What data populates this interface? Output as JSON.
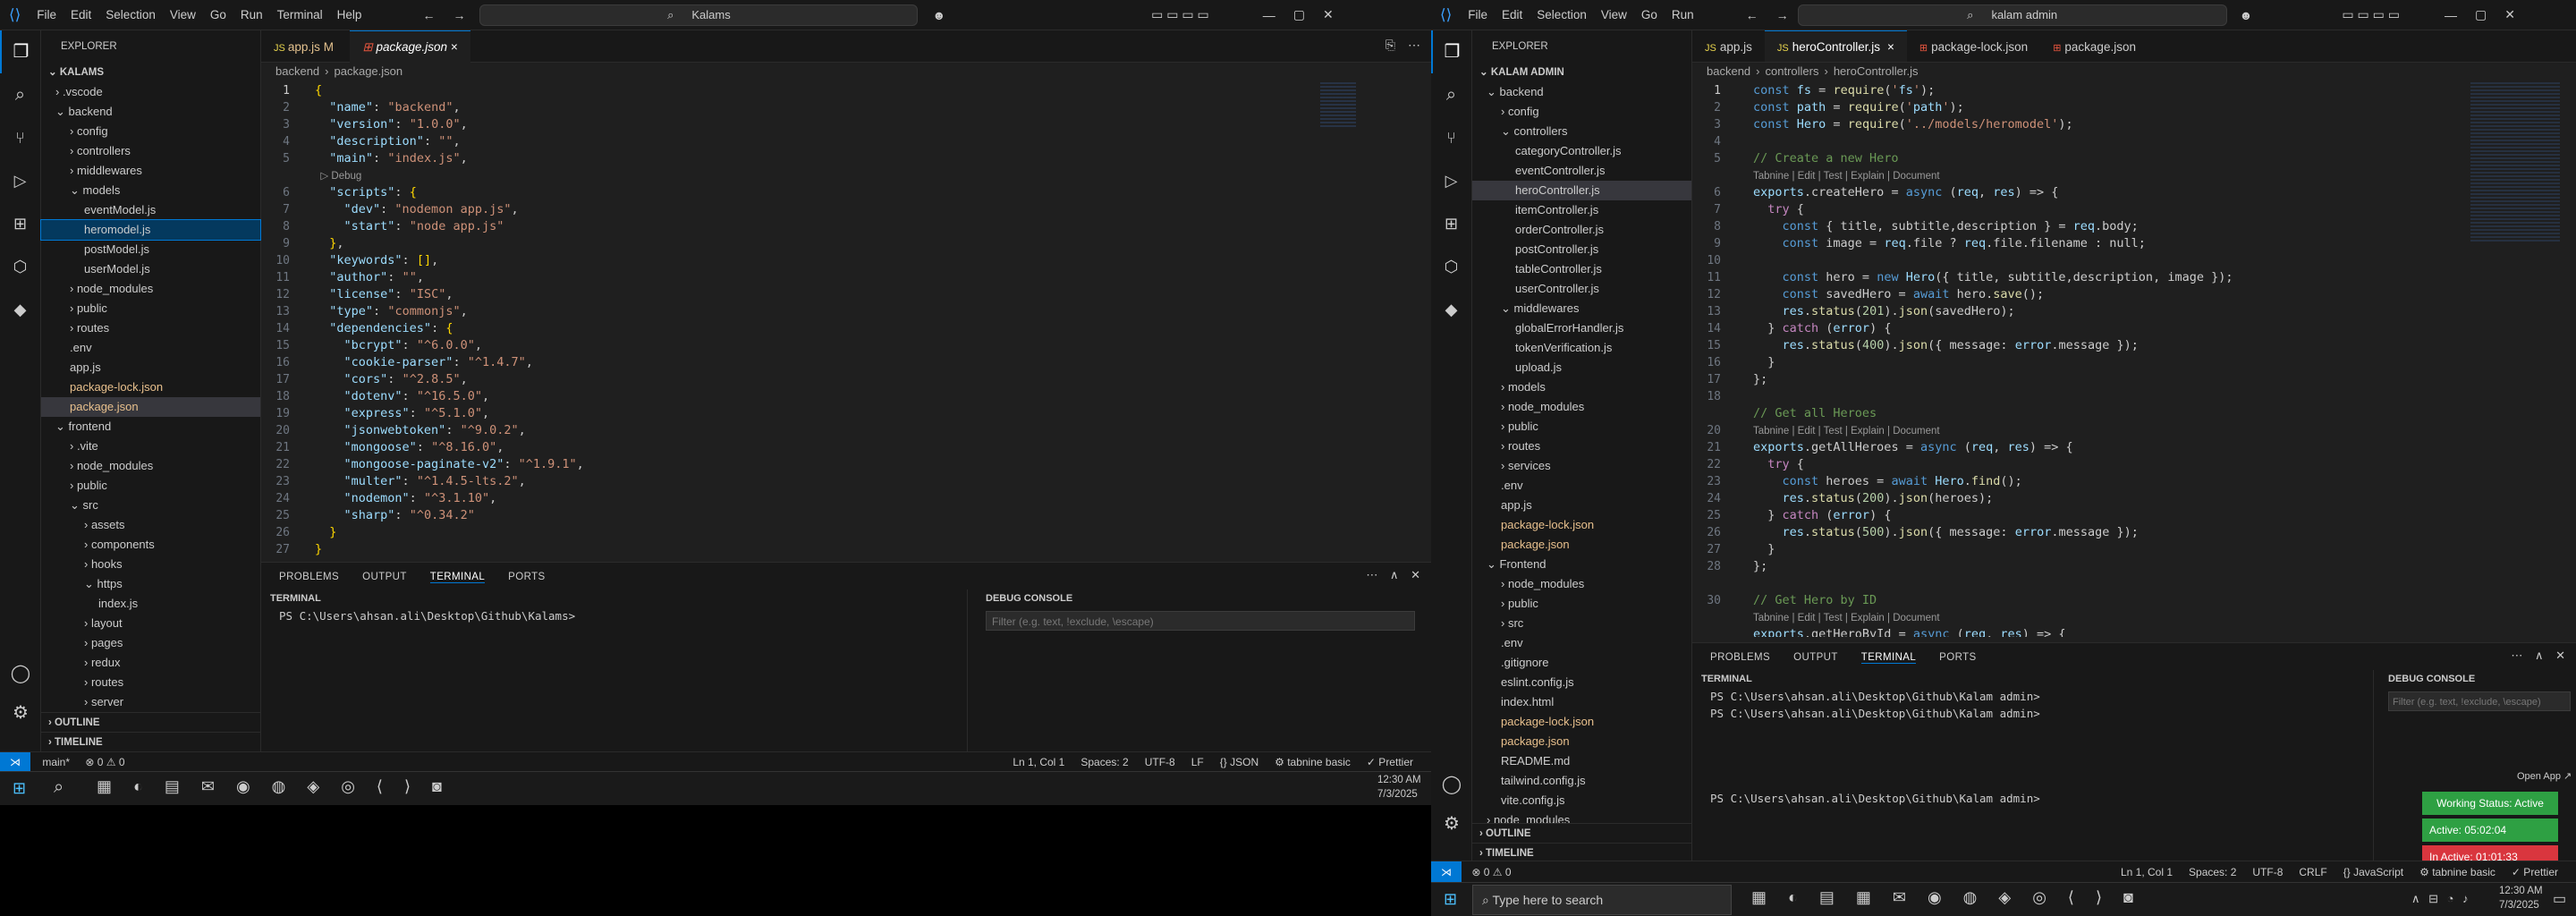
{
  "left": {
    "menu": [
      "File",
      "Edit",
      "Selection",
      "View",
      "Go",
      "Run",
      "Terminal",
      "Help"
    ],
    "search": "Kalams",
    "explorer_title": "EXPLORER",
    "root": "KALAMS",
    "tree": [
      {
        "t": "› .vscode",
        "d": 1
      },
      {
        "t": "⌄ backend",
        "d": 1
      },
      {
        "t": "› config",
        "d": 2
      },
      {
        "t": "› controllers",
        "d": 2
      },
      {
        "t": "› middlewares",
        "d": 2
      },
      {
        "t": "⌄ models",
        "d": 2
      },
      {
        "t": "eventModel.js",
        "d": 3
      },
      {
        "t": "heromodel.js",
        "d": 3
      },
      {
        "t": "postModel.js",
        "d": 3
      },
      {
        "t": "userModel.js",
        "d": 3
      },
      {
        "t": "› node_modules",
        "d": 2
      },
      {
        "t": "› public",
        "d": 2
      },
      {
        "t": "› routes",
        "d": 2
      },
      {
        "t": ".env",
        "d": 2
      },
      {
        "t": "app.js",
        "d": 2
      },
      {
        "t": "package-lock.json",
        "d": 2
      },
      {
        "t": "package.json",
        "d": 2
      },
      {
        "t": "⌄ frontend",
        "d": 1
      },
      {
        "t": "› .vite",
        "d": 2
      },
      {
        "t": "› node_modules",
        "d": 2
      },
      {
        "t": "› public",
        "d": 2
      },
      {
        "t": "⌄ src",
        "d": 2
      },
      {
        "t": "› assets",
        "d": 3
      },
      {
        "t": "› components",
        "d": 3
      },
      {
        "t": "› hooks",
        "d": 3
      },
      {
        "t": "⌄ https",
        "d": 3
      },
      {
        "t": "index.js",
        "d": 4
      },
      {
        "t": "› layout",
        "d": 3
      },
      {
        "t": "› pages",
        "d": 3
      },
      {
        "t": "› redux",
        "d": 3
      },
      {
        "t": "› routes",
        "d": 3
      },
      {
        "t": "› server",
        "d": 3
      }
    ],
    "outline": "OUTLINE",
    "timeline": "TIMELINE",
    "tabs": [
      {
        "label": "app.js",
        "flag": "M"
      },
      {
        "label": "package.json",
        "flag": "×"
      }
    ],
    "breadcrumb": [
      "backend",
      "›",
      "package.json"
    ],
    "code": [
      "{",
      "  \"name\": \"backend\",",
      "  \"version\": \"1.0.0\",",
      "  \"description\": \"\",",
      "  \"main\": \"index.js\",",
      "  ▷ Debug",
      "  \"scripts\": {",
      "    \"dev\": \"nodemon app.js\",",
      "    \"start\": \"node app.js\"",
      "  },",
      "  \"keywords\": [],",
      "  \"author\": \"\",",
      "  \"license\": \"ISC\",",
      "  \"type\": \"commonjs\",",
      "  \"dependencies\": {",
      "    \"bcrypt\": \"^6.0.0\",",
      "    \"cookie-parser\": \"^1.4.7\",",
      "    \"cors\": \"^2.8.5\",",
      "    \"dotenv\": \"^16.5.0\",",
      "    \"express\": \"^5.1.0\",",
      "    \"jsonwebtoken\": \"^9.0.2\",",
      "    \"mongoose\": \"^8.16.0\",",
      "    \"mongoose-paginate-v2\": \"^1.9.1\",",
      "    \"multer\": \"^1.4.5-lts.2\",",
      "    \"nodemon\": \"^3.1.10\",",
      "    \"sharp\": \"^0.34.2\"",
      "  }",
      "}"
    ],
    "linenums": [
      "1",
      "2",
      "3",
      "4",
      "5",
      "",
      "6",
      "7",
      "8",
      "9",
      "10",
      "11",
      "12",
      "13",
      "14",
      "15",
      "16",
      "17",
      "18",
      "19",
      "20",
      "21",
      "22",
      "23",
      "24",
      "25",
      "26",
      "27"
    ],
    "panel_tabs": [
      "PROBLEMS",
      "OUTPUT",
      "TERMINAL",
      "PORTS"
    ],
    "terminal_label": "TERMINAL",
    "terminal_line": "PS C:\\Users\\ahsan.ali\\Desktop\\Github\\Kalams>",
    "debug_label": "DEBUG CONSOLE",
    "debug_filter": "Filter (e.g. text, !exclude, \\escape)",
    "status_left": [
      "main*",
      "⊗ 0 ⚠ 0"
    ],
    "status_right": [
      "Ln 1, Col 1",
      "Spaces: 2",
      "UTF-8",
      "LF",
      "{} JSON",
      "⚙ tabnine basic",
      "✓ Prettier"
    ],
    "time": "12:30 AM",
    "date": "7/3/2025"
  },
  "right": {
    "menu": [
      "File",
      "Edit",
      "Selection",
      "View",
      "Go",
      "Run"
    ],
    "search": "kalam admin",
    "explorer_title": "EXPLORER",
    "root": "KALAM ADMIN",
    "tree": [
      {
        "t": "⌄ backend",
        "d": 1
      },
      {
        "t": "› config",
        "d": 2
      },
      {
        "t": "⌄ controllers",
        "d": 2
      },
      {
        "t": "categoryController.js",
        "d": 3
      },
      {
        "t": "eventController.js",
        "d": 3
      },
      {
        "t": "heroController.js",
        "d": 3
      },
      {
        "t": "itemController.js",
        "d": 3
      },
      {
        "t": "orderController.js",
        "d": 3
      },
      {
        "t": "postController.js",
        "d": 3
      },
      {
        "t": "tableController.js",
        "d": 3
      },
      {
        "t": "userController.js",
        "d": 3
      },
      {
        "t": "⌄ middlewares",
        "d": 2
      },
      {
        "t": "globalErrorHandler.js",
        "d": 3
      },
      {
        "t": "tokenVerification.js",
        "d": 3
      },
      {
        "t": "upload.js",
        "d": 3
      },
      {
        "t": "› models",
        "d": 2
      },
      {
        "t": "› node_modules",
        "d": 2
      },
      {
        "t": "› public",
        "d": 2
      },
      {
        "t": "› routes",
        "d": 2
      },
      {
        "t": "› services",
        "d": 2
      },
      {
        "t": ".env",
        "d": 2
      },
      {
        "t": "app.js",
        "d": 2
      },
      {
        "t": "package-lock.json",
        "d": 2
      },
      {
        "t": "package.json",
        "d": 2
      },
      {
        "t": "⌄ Frontend",
        "d": 1
      },
      {
        "t": "› node_modules",
        "d": 2
      },
      {
        "t": "› public",
        "d": 2
      },
      {
        "t": "› src",
        "d": 2
      },
      {
        "t": ".env",
        "d": 2
      },
      {
        "t": ".gitignore",
        "d": 2
      },
      {
        "t": "eslint.config.js",
        "d": 2
      },
      {
        "t": "index.html",
        "d": 2
      },
      {
        "t": "package-lock.json",
        "d": 2
      },
      {
        "t": "package.json",
        "d": 2
      },
      {
        "t": "README.md",
        "d": 2
      },
      {
        "t": "tailwind.config.js",
        "d": 2
      },
      {
        "t": "vite.config.js",
        "d": 2
      },
      {
        "t": "› node_modules",
        "d": 1
      }
    ],
    "outline": "OUTLINE",
    "timeline": "TIMELINE",
    "tabs": [
      "app.js",
      "heroController.js",
      "package-lock.json",
      "package.json"
    ],
    "breadcrumb": [
      "backend",
      "›",
      "controllers",
      "›",
      "heroController.js"
    ],
    "linenums": [
      "1",
      "2",
      "3",
      "4",
      "5",
      "",
      "6",
      "7",
      "8",
      "9",
      "10",
      "11",
      "12",
      "13",
      "14",
      "15",
      "16",
      "17",
      "18",
      "",
      "20",
      "21",
      "22",
      "23",
      "24",
      "25",
      "26",
      "27",
      "28",
      "",
      "30"
    ],
    "code": [
      "const fs = require('fs');",
      "const path = require('path');",
      "const Hero = require('../models/heromodel');",
      "",
      "// Create a new Hero",
      "Tabnine | Edit | Test | Explain | Document",
      "exports.createHero = async (req, res) => {",
      "  try {",
      "    const { title, subtitle,description } = req.body;",
      "    const image = req.file ? req.file.filename : null;",
      "",
      "    const hero = new Hero({ title, subtitle,description, image });",
      "    const savedHero = await hero.save();",
      "    res.status(201).json(savedHero);",
      "  } catch (error) {",
      "    res.status(400).json({ message: error.message });",
      "  }",
      "};",
      "",
      "// Get all Heroes",
      "Tabnine | Edit | Test | Explain | Document",
      "exports.getAllHeroes = async (req, res) => {",
      "  try {",
      "    const heroes = await Hero.find();",
      "    res.status(200).json(heroes);",
      "  } catch (error) {",
      "    res.status(500).json({ message: error.message });",
      "  }",
      "};",
      "",
      "// Get Hero by ID",
      "Tabnine | Edit | Test | Explain | Document",
      "exports.getHeroById = async (req, res) => {"
    ],
    "panel_tabs": [
      "PROBLEMS",
      "OUTPUT",
      "TERMINAL",
      "PORTS"
    ],
    "terminal_label": "TERMINAL",
    "terminal_lines": [
      "PS C:\\Users\\ahsan.ali\\Desktop\\Github\\Kalam admin>",
      "PS C:\\Users\\ahsan.ali\\Desktop\\Github\\Kalam admin>",
      "",
      "",
      "",
      "",
      "PS C:\\Users\\ahsan.ali\\Desktop\\Github\\Kalam admin>"
    ],
    "debug_label": "DEBUG CONSOLE",
    "debug_filter": "Filter (e.g. text, !exclude, \\escape)",
    "open_app": "Open App ↗",
    "working_status": "Working Status: Active",
    "active": "Active: 05:02:04",
    "inactive": "In Active: 01:01:33",
    "status_left": [
      "⊗ 0 ⚠ 0"
    ],
    "status_right": [
      "Ln 1, Col 1",
      "Spaces: 2",
      "UTF-8",
      "CRLF",
      "{} JavaScript",
      "⚙ tabnine basic",
      "✓ Prettier"
    ],
    "taskbar_search": "Type here to search",
    "time": "12:30 AM",
    "date": "7/3/2025"
  },
  "colors": {
    "accent": "#0078d4",
    "status_bar": "#181818",
    "working": "#2ea043",
    "inactive": "#d9363e"
  }
}
